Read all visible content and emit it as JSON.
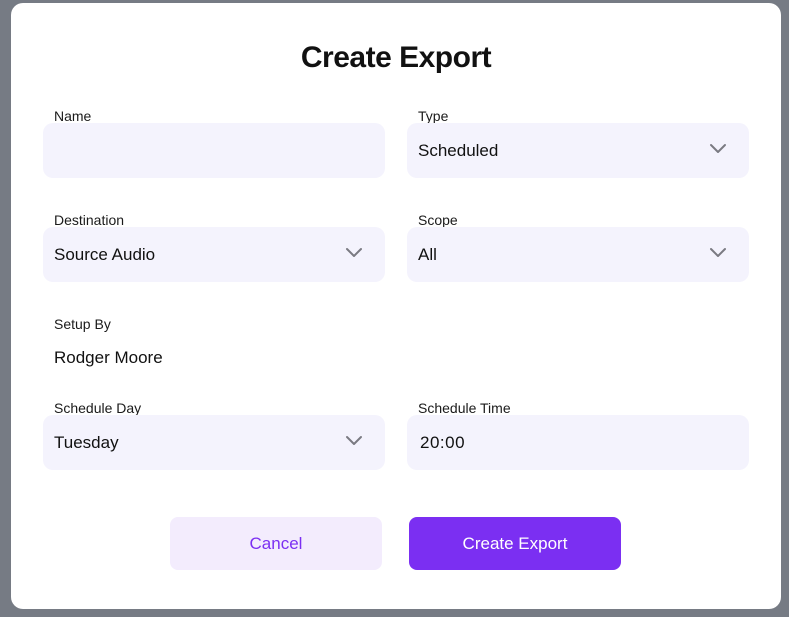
{
  "dialog": {
    "title": "Create Export"
  },
  "fields": {
    "name": {
      "label": "Name",
      "value": ""
    },
    "type": {
      "label": "Type",
      "value": "Scheduled"
    },
    "destination": {
      "label": "Destination",
      "value": "Source Audio"
    },
    "scope": {
      "label": "Scope",
      "value": "All"
    },
    "setup_by": {
      "label": "Setup By",
      "value": "Rodger Moore"
    },
    "schedule_day": {
      "label": "Schedule Day",
      "value": "Tuesday"
    },
    "schedule_time": {
      "label": "Schedule Time",
      "value": "20:00"
    }
  },
  "buttons": {
    "cancel_label": "Cancel",
    "create_label": "Create Export"
  },
  "colors": {
    "accent": "#7b2ff2",
    "input_bg": "#f4f3fd",
    "cancel_bg": "#f3ecfd",
    "backdrop": "#767b84"
  }
}
